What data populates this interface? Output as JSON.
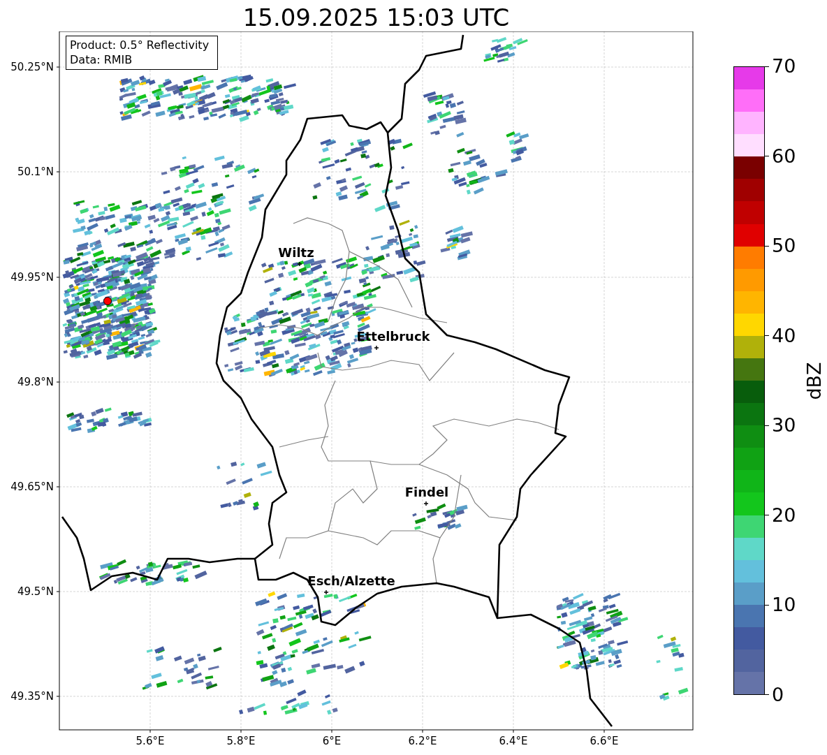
{
  "title": "15.09.2025 15:03 UTC",
  "info_box": {
    "lines": [
      "Product: 0.5° Reflectivity",
      "Data: RMIB"
    ]
  },
  "map": {
    "x_ticks": [
      "5.6°E",
      "5.8°E",
      "6°E",
      "6.2°E",
      "6.4°E",
      "6.6°E"
    ],
    "y_ticks": [
      "50.25°N",
      "50.1°N",
      "49.95°N",
      "49.8°N",
      "49.65°N",
      "49.5°N",
      "49.35°N"
    ],
    "places": [
      {
        "name": "Wiltz"
      },
      {
        "name": "Ettelbruck"
      },
      {
        "name": "Findel"
      },
      {
        "name": "Esch/Alzette"
      }
    ]
  },
  "colorbar": {
    "label": "dBZ",
    "ticks": [
      "70",
      "60",
      "50",
      "40",
      "30",
      "20",
      "10",
      "0"
    ],
    "bins": [
      {
        "color": "#6573a8"
      },
      {
        "color": "#52649f"
      },
      {
        "color": "#435aa0"
      },
      {
        "color": "#4a75b0"
      },
      {
        "color": "#5a9ec8"
      },
      {
        "color": "#63c0dc"
      },
      {
        "color": "#5fd8c8"
      },
      {
        "color": "#3ed673"
      },
      {
        "color": "#13c61c"
      },
      {
        "color": "#10b518"
      },
      {
        "color": "#10a214"
      },
      {
        "color": "#0f8e12"
      },
      {
        "color": "#0b7510"
      },
      {
        "color": "#085d0c"
      },
      {
        "color": "#457610"
      },
      {
        "color": "#b0b10a"
      },
      {
        "color": "#ffd700"
      },
      {
        "color": "#ffb500"
      },
      {
        "color": "#ff9a00"
      },
      {
        "color": "#ff7c00"
      },
      {
        "color": "#e00000"
      },
      {
        "color": "#c00000"
      },
      {
        "color": "#a00000"
      },
      {
        "color": "#7a0000"
      },
      {
        "color": "#ffdeff"
      },
      {
        "color": "#ffb4ff"
      },
      {
        "color": "#ff6ef8"
      },
      {
        "color": "#e63ae9"
      }
    ]
  }
}
